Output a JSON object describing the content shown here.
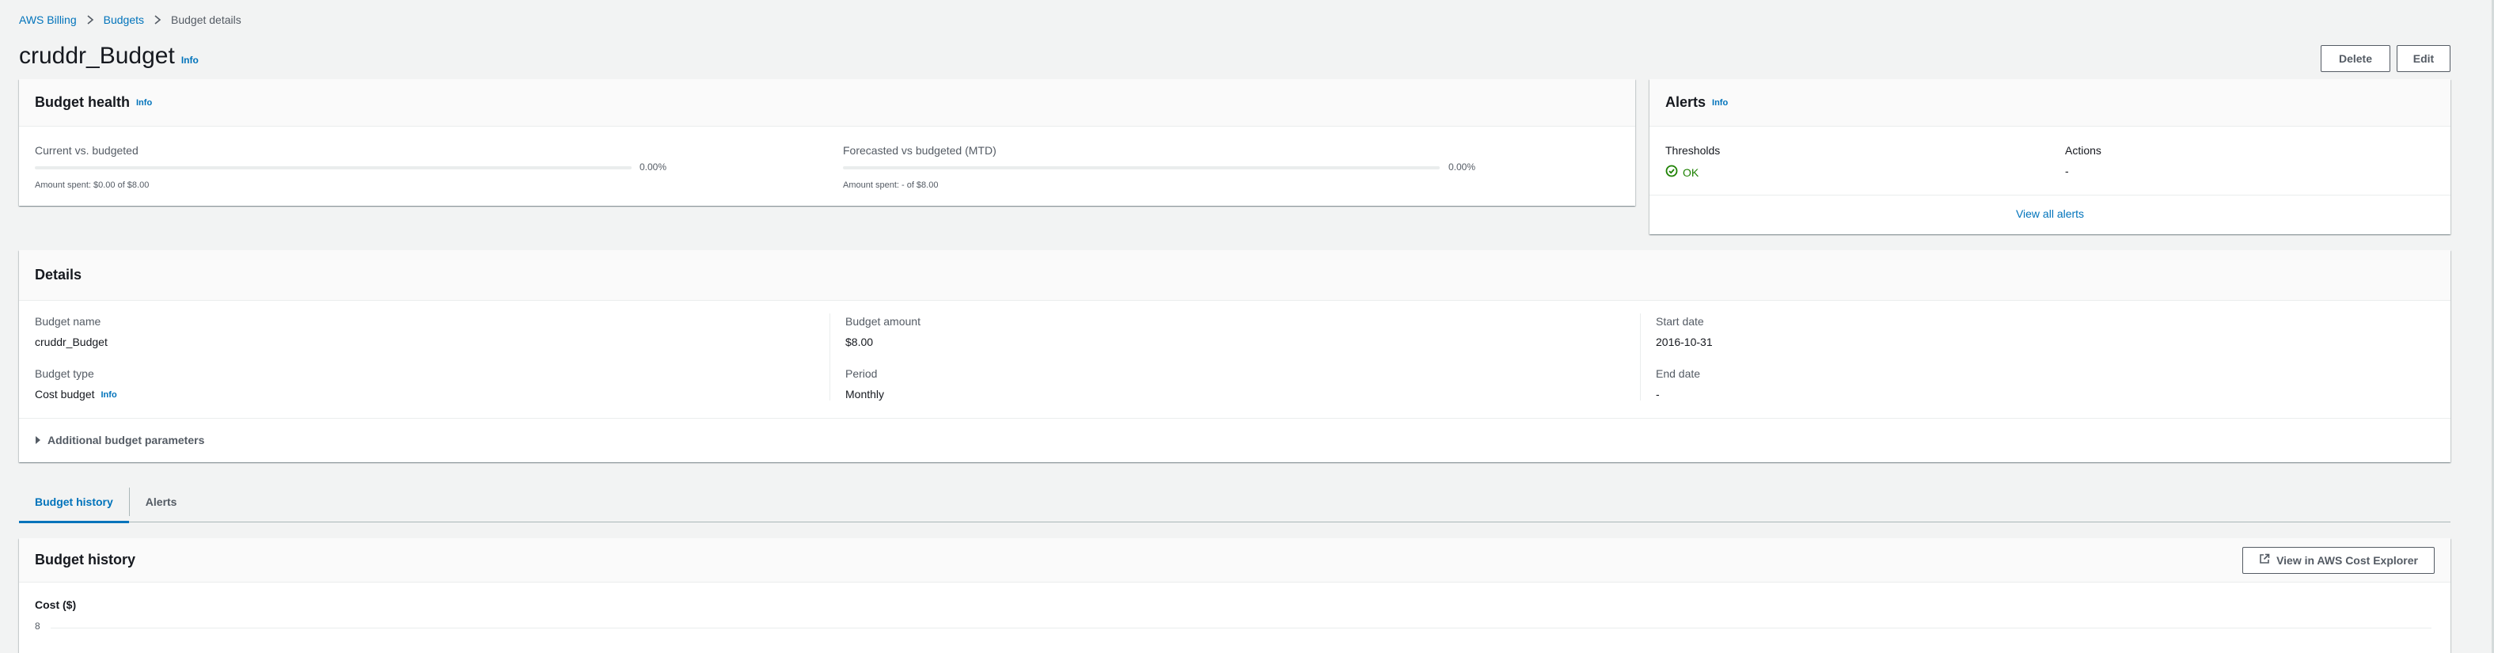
{
  "breadcrumb": {
    "items": [
      "AWS Billing",
      "Budgets"
    ],
    "current": "Budget details"
  },
  "header": {
    "title": "cruddr_Budget",
    "info": "Info",
    "delete_label": "Delete",
    "edit_label": "Edit"
  },
  "health": {
    "title": "Budget health",
    "info": "Info",
    "current": {
      "label": "Current vs. budgeted",
      "percent": "0.00%",
      "amount": "Amount spent: $0.00 of $8.00",
      "progress": 0
    },
    "forecast": {
      "label": "Forecasted vs budgeted (MTD)",
      "percent": "0.00%",
      "amount": "Amount spent: - of $8.00",
      "progress": 0
    }
  },
  "alerts": {
    "title": "Alerts",
    "info": "Info",
    "thresholds_label": "Thresholds",
    "thresholds_value": "OK",
    "actions_label": "Actions",
    "actions_value": "-",
    "view_all": "View all alerts"
  },
  "details": {
    "title": "Details",
    "budget_name_label": "Budget name",
    "budget_name": "cruddr_Budget",
    "budget_type_label": "Budget type",
    "budget_type": "Cost budget",
    "info": "Info",
    "budget_amount_label": "Budget amount",
    "budget_amount": "$8.00",
    "period_label": "Period",
    "period": "Monthly",
    "start_date_label": "Start date",
    "start_date": "2016-10-31",
    "end_date_label": "End date",
    "end_date": "-",
    "additional": "Additional budget parameters"
  },
  "tabs": [
    "Budget history",
    "Alerts"
  ],
  "history": {
    "title": "Budget history",
    "explorer_label": "View in AWS Cost Explorer",
    "chart_label": "Cost ($)",
    "y_tick": "8"
  },
  "colors": {
    "link": "#0073bb",
    "ok": "#1d8102",
    "background": "#f2f3f3"
  }
}
